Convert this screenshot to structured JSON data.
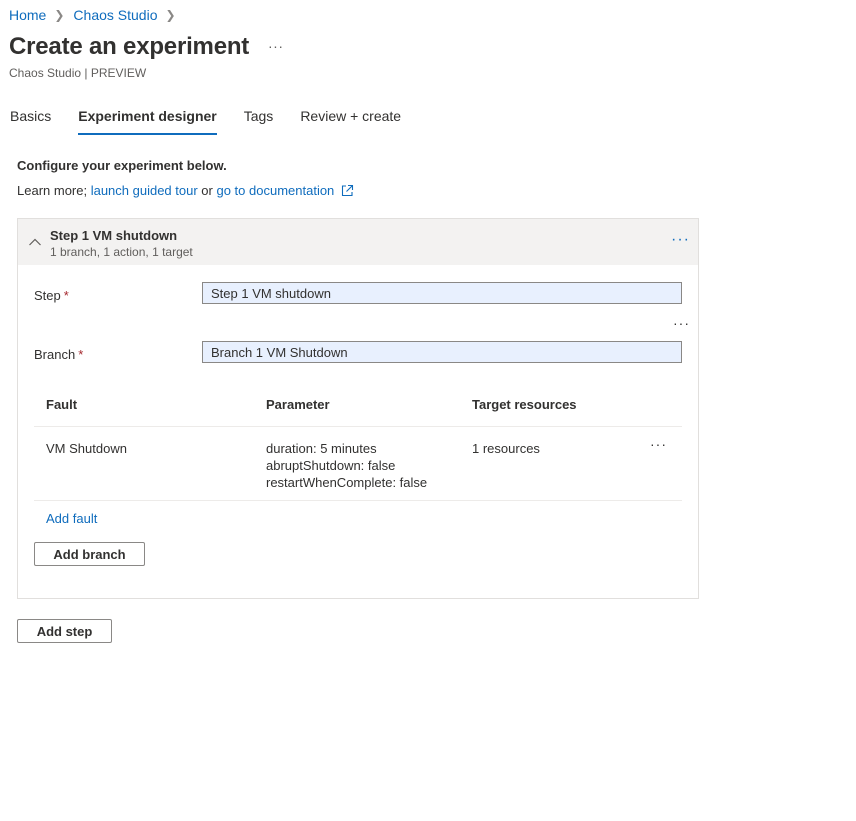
{
  "breadcrumb": {
    "items": [
      "Home",
      "Chaos Studio"
    ]
  },
  "page": {
    "title": "Create an experiment",
    "more": "···",
    "subtitle": "Chaos Studio | PREVIEW"
  },
  "tabs": [
    {
      "label": "Basics",
      "active": false
    },
    {
      "label": "Experiment designer",
      "active": true
    },
    {
      "label": "Tags",
      "active": false
    },
    {
      "label": "Review + create",
      "active": false
    }
  ],
  "intro": {
    "configure": "Configure your experiment below.",
    "learn_prefix": "Learn more; ",
    "tour_link": "launch guided tour",
    "or": " or ",
    "docs_link": "go to documentation"
  },
  "step": {
    "title": "Step 1 VM shutdown",
    "summary": "1 branch, 1 action, 1 target",
    "more": "···",
    "step_label": "Step",
    "step_value": "Step 1 VM shutdown",
    "branch_label": "Branch",
    "branch_value": "Branch 1 VM Shutdown",
    "branch_more": "···",
    "required_mark": "*",
    "table": {
      "headers": [
        "Fault",
        "Parameter",
        "Target resources"
      ],
      "rows": [
        {
          "fault": "VM Shutdown",
          "params": [
            "duration: 5 minutes",
            "abruptShutdown: false",
            "restartWhenComplete: false"
          ],
          "targets": "1 resources",
          "more": "···"
        }
      ]
    },
    "add_fault": "Add fault",
    "add_branch": "Add branch"
  },
  "add_step": "Add step",
  "colors": {
    "accent": "#0f6cbd",
    "required": "#a4262c",
    "field_bg": "#e8f0fe",
    "header_bg": "#f3f2f1"
  }
}
